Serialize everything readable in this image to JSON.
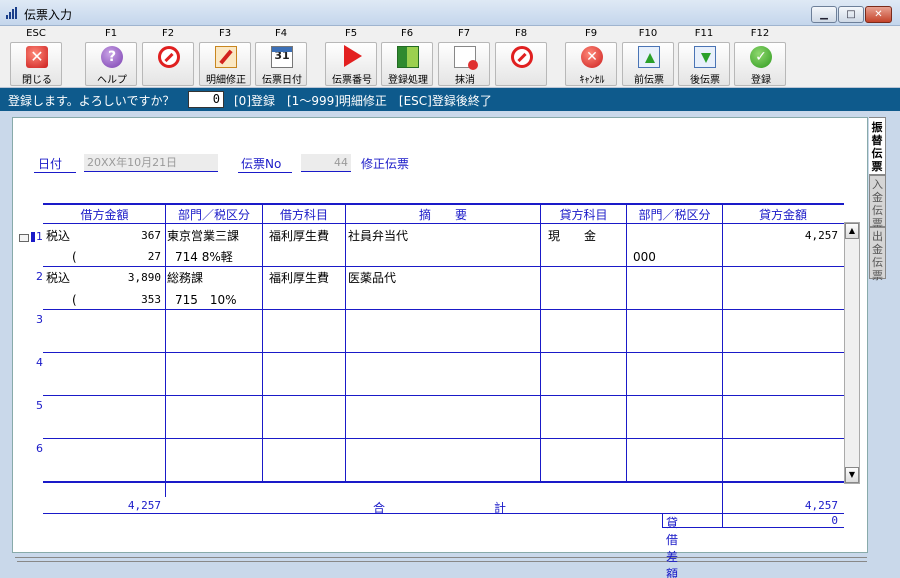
{
  "window": {
    "title": "伝票入力",
    "btn_min": "▁",
    "btn_max": "□",
    "btn_close": "✕"
  },
  "toolbar": [
    {
      "key": "ESC",
      "label": "閉じる",
      "icon": "close-icon"
    },
    {
      "key": "F1",
      "label": "ヘルプ",
      "icon": "help-icon"
    },
    {
      "key": "F2",
      "label": "",
      "icon": "disabled-icon"
    },
    {
      "key": "F3",
      "label": "明細修正",
      "icon": "edit-icon"
    },
    {
      "key": "F4",
      "label": "伝票日付",
      "icon": "calendar-icon",
      "icon_text": "31"
    },
    {
      "key": "F5",
      "label": "伝票番号",
      "icon": "play-icon"
    },
    {
      "key": "F6",
      "label": "登録処理",
      "icon": "book-icon"
    },
    {
      "key": "F7",
      "label": "抹消",
      "icon": "delete-doc-icon"
    },
    {
      "key": "F8",
      "label": "",
      "icon": "disabled-icon"
    },
    {
      "key": "F9",
      "label": "ｷｬﾝｾﾙ",
      "icon": "cancel-icon"
    },
    {
      "key": "F10",
      "label": "前伝票",
      "icon": "prev-voucher-icon"
    },
    {
      "key": "F11",
      "label": "後伝票",
      "icon": "next-voucher-icon"
    },
    {
      "key": "F12",
      "label": "登録",
      "icon": "confirm-icon"
    }
  ],
  "prompt": {
    "text": "登録します。よろしいですか？",
    "value": "0",
    "options": "[0]登録　[1～999]明細修正　[ESC]登録後終了"
  },
  "header": {
    "date_label": "日付",
    "date_value": "20XX年10月21日",
    "voucher_label": "伝票No",
    "voucher_value": "44",
    "mode": "修正伝票"
  },
  "tabs": [
    "振替伝票",
    "入金伝票",
    "出金伝票"
  ],
  "columns": [
    "借方金額",
    "部門／税区分",
    "借方科目",
    "摘　　要",
    "貸方科目",
    "部門／税区分",
    "貸方金額"
  ],
  "rows": [
    {
      "no": "1",
      "debit_tax": "税込",
      "debit_amount": "367",
      "debit_dept": "東京営業三課",
      "debit_account": "福利厚生費",
      "summary": "社員弁当代",
      "credit_account": "現　　金",
      "credit_dept": "",
      "credit_amount": "4,257",
      "debit_sub_prefix": "(",
      "debit_sub_amount": "27",
      "debit_sub_tax": "714 8%軽",
      "credit_sub_tax": "000"
    },
    {
      "no": "2",
      "debit_tax": "税込",
      "debit_amount": "3,890",
      "debit_dept": "総務課",
      "debit_account": "福利厚生費",
      "summary": "医薬品代",
      "credit_account": "",
      "credit_dept": "",
      "credit_amount": "",
      "debit_sub_prefix": "(",
      "debit_sub_amount": "353",
      "debit_sub_tax": "715　10%",
      "credit_sub_tax": ""
    },
    {
      "no": "3"
    },
    {
      "no": "4"
    },
    {
      "no": "5"
    },
    {
      "no": "6"
    }
  ],
  "totals": {
    "debit_total": "4,257",
    "label_left": "合",
    "label_right": "計",
    "credit_total": "4,257",
    "diff_label": "貸借差額",
    "diff_value": "0"
  },
  "colors": {
    "accent": "#1a1ac8",
    "prompt_bg": "#0e5a8c"
  }
}
